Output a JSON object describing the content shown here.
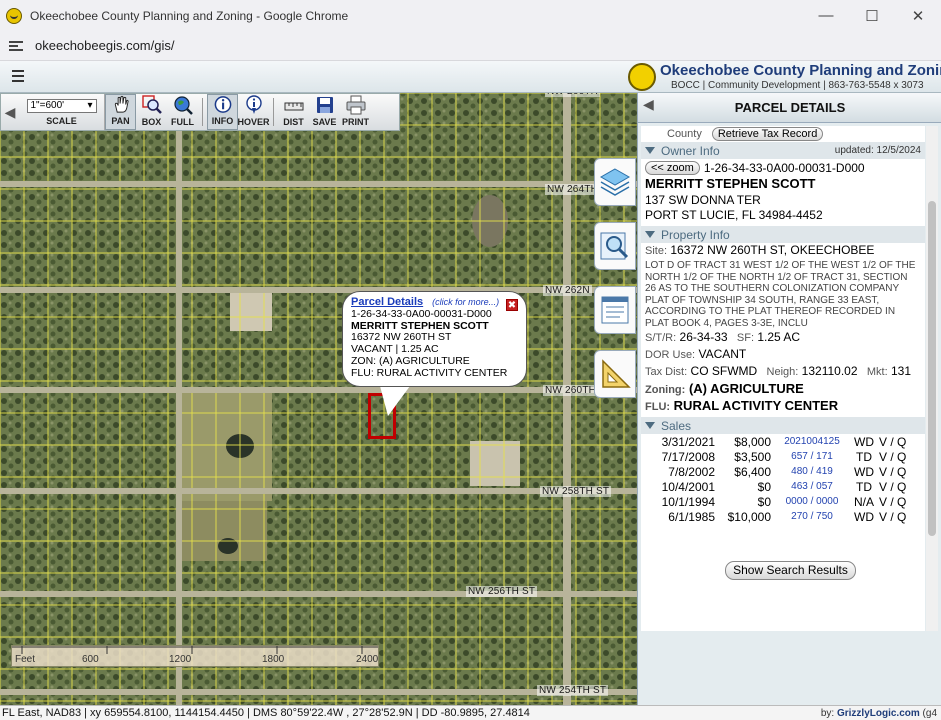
{
  "browser": {
    "window_title": "Okeechobee County Planning and Zoning - Google Chrome",
    "url": "okeechobeegis.com/gis/"
  },
  "banner": {
    "title": "Okeechobee County Planning and Zoning",
    "subtitle": "BOCC | Community Development | 863-763-5548 x 3073"
  },
  "toolbar": {
    "scale_value": "1\"=600'",
    "scale_label": "SCALE",
    "tools": [
      {
        "label": "PAN",
        "icon": "hand-icon",
        "active": true
      },
      {
        "label": "BOX",
        "icon": "box-zoom-icon",
        "active": false
      },
      {
        "label": "FULL",
        "icon": "globe-icon",
        "active": false
      },
      {
        "label": "INFO",
        "icon": "info-icon",
        "active": true
      },
      {
        "label": "HOVER",
        "icon": "hover-info-icon",
        "active": false
      },
      {
        "label": "DIST",
        "icon": "ruler-icon",
        "active": false
      },
      {
        "label": "SAVE",
        "icon": "save-icon",
        "active": false
      },
      {
        "label": "PRINT",
        "icon": "printer-icon",
        "active": false
      }
    ]
  },
  "map": {
    "road_labels": {
      "r264": "NW 264TH",
      "r262": "NW 262N",
      "r260": "NW 260TH",
      "r258": "NW 258TH ST",
      "r256": "NW 256TH ST",
      "r254": "NW 254TH ST",
      "rtop": "NW 266TH"
    },
    "scalebar": {
      "unit": "Feet",
      "ticks": [
        "600",
        "1200",
        "1800",
        "2400"
      ]
    }
  },
  "popup": {
    "title": "Parcel Details",
    "more": "(click for more...)",
    "lines": [
      "1-26-34-33-0A00-00031-D000",
      "MERRITT STEPHEN SCOTT",
      "16372 NW 260TH ST",
      "VACANT | 1.25 AC",
      "ZON: (A) AGRICULTURE",
      "FLU: RURAL ACTIVITY CENTER"
    ]
  },
  "panel": {
    "title": "PARCEL DETAILS",
    "county_label": "County",
    "tax_button": "Retrieve Tax Record",
    "owner": {
      "heading": "Owner Info",
      "updated": "updated: 12/5/2024",
      "zoom_button": "<< zoom",
      "parcel_id": "1-26-34-33-0A00-00031-D000",
      "name": "MERRITT STEPHEN SCOTT",
      "addr1": "137 SW DONNA TER",
      "addr2": "PORT ST LUCIE, FL 34984-4452"
    },
    "property": {
      "heading": "Property Info",
      "site_label": "Site:",
      "site": "16372 NW 260TH ST, OKEECHOBEE",
      "legal": "LOT D OF TRACT 31  WEST 1/2 OF THE WEST 1/2 OF THE NORTH 1/2 OF THE NORTH 1/2 OF TRACT 31, SECTION 26 AS TO THE SOUTHERN COLONIZATION COMPANY PLAT OF TOWNSHIP 34 SOUTH, RANGE 33 EAST, ACCORDING TO THE PLAT THEREOF RECORDED IN PLAT BOOK 4, PAGES 3-3E, INCLU",
      "str_label": "S/T/R:",
      "str": "26-34-33",
      "sf_label": "SF:",
      "sf": "1.25 AC",
      "dor_label": "DOR Use:",
      "dor": "VACANT",
      "taxdist_label": "Tax Dist:",
      "taxdist": "CO SFWMD",
      "neigh_label": "Neigh:",
      "neigh": "132110.02",
      "mkt_label": "Mkt:",
      "mkt": "131",
      "zoning_label": "Zoning:",
      "zoning": "(A) AGRICULTURE",
      "flu_label": "FLU:",
      "flu": "RURAL ACTIVITY CENTER"
    },
    "sales": {
      "heading": "Sales",
      "rows": [
        {
          "date": "3/31/2021",
          "price": "$8,000",
          "book": "2021004125",
          "type": "WD",
          "vq": "V / Q"
        },
        {
          "date": "7/17/2008",
          "price": "$3,500",
          "book": "657 / 171",
          "type": "TD",
          "vq": "V / Q"
        },
        {
          "date": "7/8/2002",
          "price": "$6,400",
          "book": "480 / 419",
          "type": "WD",
          "vq": "V / Q"
        },
        {
          "date": "10/4/2001",
          "price": "$0",
          "book": "463 / 057",
          "type": "TD",
          "vq": "V / Q"
        },
        {
          "date": "10/1/1994",
          "price": "$0",
          "book": "0000 / 0000",
          "type": "N/A",
          "vq": "V / Q"
        },
        {
          "date": "6/1/1985",
          "price": "$10,000",
          "book": "270 / 750",
          "type": "WD",
          "vq": "V / Q"
        }
      ]
    },
    "show_results": "Show Search Results"
  },
  "status": {
    "coords": "FL East, NAD83 | xy 659554.8100, 1144154.4450 | DMS 80°59'22.4W , 27°28'52.9N | DD -80.9895, 27.4814",
    "credit_prefix": "by:",
    "credit": "GrizzlyLogic.com",
    "credit_suffix": "(g4"
  }
}
